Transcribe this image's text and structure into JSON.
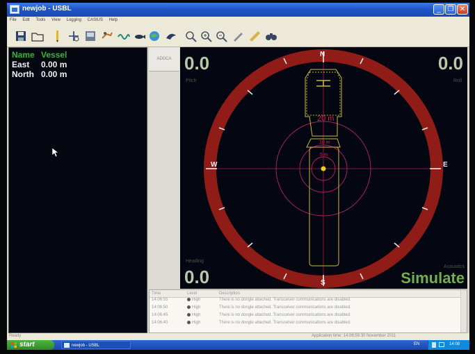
{
  "window": {
    "title": "newjob - USBL"
  },
  "menu": [
    "File",
    "Edit",
    "Tools",
    "View",
    "Logging",
    "CASIUS",
    "Help"
  ],
  "toolbar": [
    "save-icon",
    "open-folder-icon",
    "pencil-icon",
    "add-target-icon",
    "gps-icon",
    "diver-icon",
    "wave-icon",
    "fish-icon",
    "globe-icon",
    "dolphin-icon",
    "zoom-fit-icon",
    "zoom-in-icon",
    "zoom-out-icon",
    "pen-icon",
    "ruler-icon",
    "binoculars-icon"
  ],
  "left_pane": {
    "headers": {
      "name": "Name",
      "value": "Vessel"
    },
    "rows": [
      {
        "label": "East",
        "value": "0.00 m"
      },
      {
        "label": "North",
        "value": "0.00 m"
      }
    ]
  },
  "tab_strip": {
    "adcp": "ADDCA"
  },
  "display": {
    "pitch_value": "0.0",
    "pitch_label": "Pitch",
    "roll_value": "0.0",
    "roll_label": "Roll",
    "heading_value": "0.0",
    "heading_label": "Heading",
    "acoustics_label": "Acoustics",
    "mode": "Simulate",
    "compass": {
      "n": "N",
      "s": "S",
      "e": "E",
      "w": "W"
    },
    "ranges": [
      "20 m",
      "10 m",
      "5 m"
    ]
  },
  "log": {
    "headers": {
      "time": "Time",
      "level": "Level",
      "description": "Description"
    },
    "rows": [
      {
        "time": "14:06:55",
        "level": "High",
        "description": "There is no dongle attached. Transceiver communications are disabled."
      },
      {
        "time": "14:06:50",
        "level": "High",
        "description": "There is no dongle attached. Transceiver communications are disabled."
      },
      {
        "time": "14:06:45",
        "level": "High",
        "description": "There is no dongle attached. Transceiver communications are disabled."
      },
      {
        "time": "14:06:40",
        "level": "High",
        "description": "There is no dongle attached. Transceiver communications are disabled."
      }
    ]
  },
  "status": {
    "ready": "Ready",
    "app_time": "Application time: 14:06:59  30 November 2011"
  },
  "taskbar": {
    "start": "start",
    "task": "newjob - USBL",
    "lang": "EN",
    "clock": "14:08"
  }
}
